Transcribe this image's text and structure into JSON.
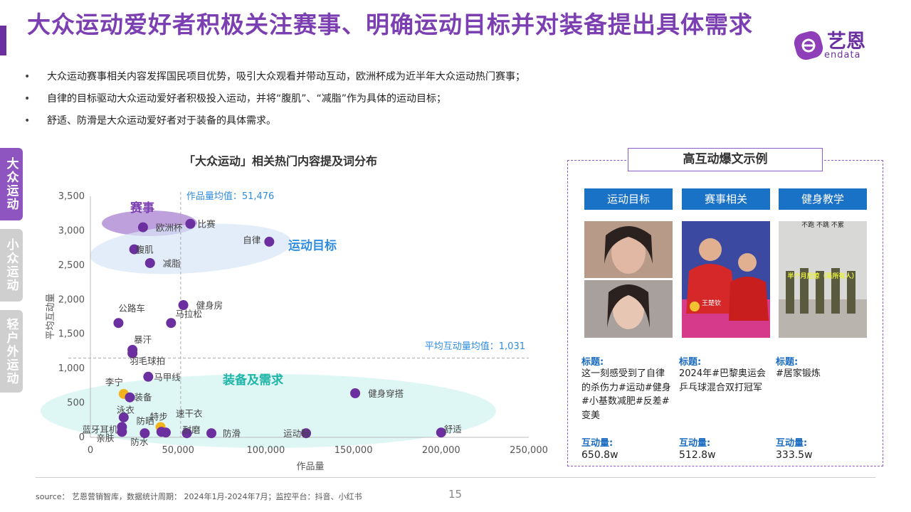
{
  "title": "大众运动爱好者积极关注赛事、明确运动目标并对装备提出具体需求",
  "logo": {
    "name": "艺恩",
    "sub": "endata"
  },
  "bullets": [
    "大众运动赛事相关内容发挥国民项目优势，吸引大众观看并带动互动，欧洲杯成为近半年大众运动热门赛事；",
    "自律的目标驱动大众运动爱好者积极投入运动，并将“腹肌”、“减脂”作为具体的运动目标；",
    "舒适、防滑是大众运动爱好者对于装备的具体需求。"
  ],
  "bullet_marker": "•",
  "side_tabs": [
    "大众运动",
    "小众运动",
    "轻户外运动"
  ],
  "chart_data": {
    "type": "scatter",
    "title": "「大众运动」相关热门内容提及词分布",
    "xlabel": "作品量",
    "ylabel": "平均互动量",
    "xlim": [
      0,
      250000
    ],
    "ylim": [
      0,
      3500
    ],
    "xticks": [
      0,
      50000,
      100000,
      150000,
      200000,
      250000
    ],
    "xtick_labels": [
      "0",
      "50,000",
      "100,000",
      "150,000",
      "200,000",
      "250,000"
    ],
    "yticks": [
      0,
      500,
      1000,
      1500,
      2000,
      2500,
      3000,
      3500
    ],
    "ytick_labels": [
      "0",
      "500",
      "1,000",
      "1,500",
      "2,000",
      "2,500",
      "3,000",
      "3,500"
    ],
    "x_mean": {
      "value": 51476,
      "label": "作品量均值：51,476"
    },
    "y_mean": {
      "value": 1150,
      "label": "平均互动量均值：1,031"
    },
    "groups": [
      {
        "name": "赛事",
        "color": "#7b3fb1",
        "fill": "#b38fd6"
      },
      {
        "name": "运动目标",
        "color": "#2f8de0",
        "fill": "#d5e6f7"
      },
      {
        "name": "装备及需求",
        "color": "#1fb5a7",
        "fill": "#d4f4f0"
      }
    ],
    "points": [
      {
        "label": "欧洲杯",
        "x": 30000,
        "y": 3050,
        "color": "#6b2fa0"
      },
      {
        "label": "比赛",
        "x": 57000,
        "y": 3100,
        "color": "#6b2fa0"
      },
      {
        "label": "腹肌",
        "x": 25000,
        "y": 2730,
        "color": "#6b2fa0"
      },
      {
        "label": "自律",
        "x": 102000,
        "y": 2840,
        "color": "#6b2fa0"
      },
      {
        "label": "减脂",
        "x": 34000,
        "y": 2530,
        "color": "#6b2fa0"
      },
      {
        "label": "健身房",
        "x": 53000,
        "y": 1920,
        "color": "#6b2fa0"
      },
      {
        "label": "公路车",
        "x": 16000,
        "y": 1660,
        "color": "#6b2fa0"
      },
      {
        "label": "马拉松",
        "x": 46000,
        "y": 1660,
        "color": "#6b2fa0"
      },
      {
        "label": "暴汗",
        "x": 24000,
        "y": 1270,
        "color": "#6b2fa0"
      },
      {
        "label": "羽毛球拍",
        "x": 24000,
        "y": 1220,
        "color": "#6b2fa0"
      },
      {
        "label": "马甲线",
        "x": 33000,
        "y": 880,
        "color": "#6b2fa0"
      },
      {
        "label": "健身穿搭",
        "x": 151000,
        "y": 640,
        "color": "#6b2fa0"
      },
      {
        "label": "李宁",
        "x": 19000,
        "y": 630,
        "color": "#f2b31c"
      },
      {
        "label": "装备",
        "x": 22500,
        "y": 580,
        "color": "#6b2fa0"
      },
      {
        "label": "泳衣",
        "x": 19000,
        "y": 290,
        "color": "#6b2fa0"
      },
      {
        "label": "蓝牙耳机",
        "x": 18000,
        "y": 150,
        "color": "#6b2fa0"
      },
      {
        "label": "防晒",
        "x": 40000,
        "y": 150,
        "color": "#f2b31c"
      },
      {
        "label": "特步",
        "x": 40500,
        "y": 80,
        "color": "#6b2fa0"
      },
      {
        "label": "速干衣",
        "x": 43000,
        "y": 70,
        "color": "#6b2fa0"
      },
      {
        "label": "亲肤",
        "x": 18000,
        "y": 80,
        "color": "#6b2fa0"
      },
      {
        "label": "防水",
        "x": 31000,
        "y": 60,
        "color": "#6b2fa0"
      },
      {
        "label": "耐磨",
        "x": 55000,
        "y": 60,
        "color": "#6b2fa0"
      },
      {
        "label": "防滑",
        "x": 69000,
        "y": 60,
        "color": "#6b2fa0"
      },
      {
        "label": "运动鞋",
        "x": 123000,
        "y": 60,
        "color": "#6b2fa0"
      },
      {
        "label": "舒适",
        "x": 200000,
        "y": 70,
        "color": "#6b2fa0"
      }
    ]
  },
  "panel": {
    "title": "高互动爆文示例",
    "columns": [
      {
        "header": "运动目标",
        "label": "标题:",
        "text": "这一刻感受到了自律的杀伤力#运动#健身#小基数减肥#反差#变美",
        "metric_label": "互动量:",
        "metric": "650.8w"
      },
      {
        "header": "赛事相关",
        "label": "标题:",
        "text": "2024年#巴黎奥运会乒乓球混合双打冠军",
        "metric_label": "互动量:",
        "metric": "512.8w",
        "image_caption": "王楚钦"
      },
      {
        "header": "健身教学",
        "label": "标题:",
        "text": "#居家锻炼",
        "metric_label": "互动量:",
        "metric": "333.5w",
        "image_top": "不跑 不跳 不累",
        "image_mid": "半个月后惊（呆所有人）"
      }
    ]
  },
  "source": "source： 艺恩营销智库，数据统计周期： 2024年1月-2024年7月；监控平台：抖音、小红书",
  "page_number": "15"
}
